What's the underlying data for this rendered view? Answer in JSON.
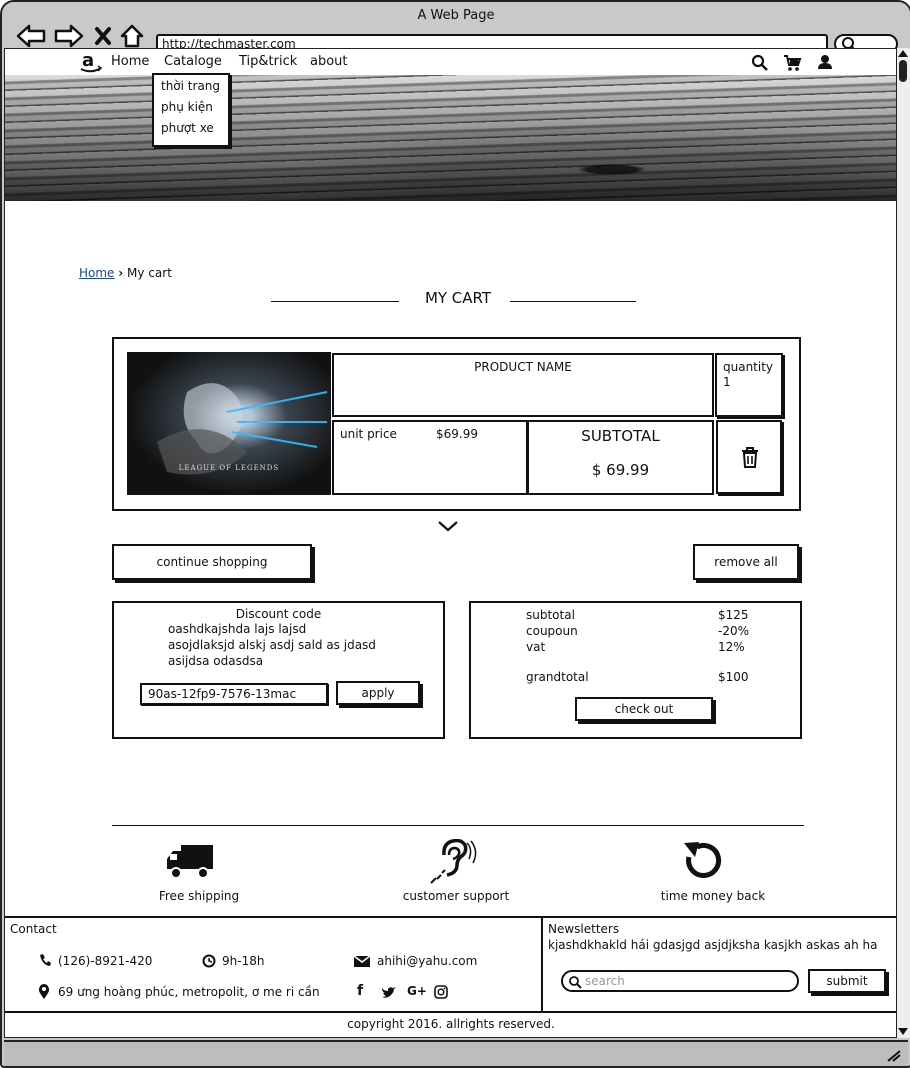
{
  "window": {
    "title": "A Web Page",
    "url": "http://techmaster.com"
  },
  "nav": {
    "items": [
      "Home",
      "Cataloge",
      "Tip&trick",
      "about"
    ],
    "dropdown": [
      "thời trang",
      "phụ kiện",
      "phượt xe"
    ]
  },
  "breadcrumb": {
    "home": "Home",
    "current": "My cart"
  },
  "page_title": "MY CART",
  "cart_item": {
    "image_caption": "LEAGUE OF LEGENDS",
    "product_name": "PRODUCT NAME",
    "quantity_label": "quantity",
    "quantity_value": "1",
    "unit_price_label": "unit price",
    "unit_price_value": "$69.99",
    "subtotal_label": "SUBTOTAL",
    "subtotal_value": "$ 69.99"
  },
  "buttons": {
    "continue_shopping": "continue shopping",
    "remove_all": "remove all",
    "apply": "apply",
    "check_out": "check out",
    "submit": "submit"
  },
  "discount": {
    "title": "Discount code",
    "lines": [
      "oashdkajshda lajs lajsd",
      "asojdlaksjd alskj asdj sald as jdasd",
      "asijdsa odasdsa"
    ],
    "code_value": "90as-12fp9-7576-13mac"
  },
  "summary": {
    "rows": [
      {
        "label": "subtotal",
        "value": "$125"
      },
      {
        "label": "coupoun",
        "value": "-20%"
      },
      {
        "label": "vat",
        "value": "12%"
      }
    ],
    "grandtotal_label": "grandtotal",
    "grandtotal_value": "$100"
  },
  "features": [
    "Free shipping",
    "customer support",
    "time money back"
  ],
  "contact": {
    "title": "Contact",
    "phone": "(126)-8921-420",
    "hours": "9h-18h",
    "email": "ahihi@yahu.com",
    "address": "69 ưng hoàng phúc, metropolit, ơ me ri cần"
  },
  "newsletter": {
    "title": "Newsletters",
    "text": "kjashdkhakld hái gdasjgd asjdjksha kasjkh askas ah ha",
    "search_placeholder": "search"
  },
  "copyright": "copyright 2016. allrights reserved.",
  "icons": [
    "back-arrow-icon",
    "forward-arrow-icon",
    "close-icon",
    "home-icon",
    "search-icon",
    "cart-icon",
    "user-icon",
    "amazon-logo",
    "trash-icon",
    "chevron-down-icon",
    "truck-icon",
    "ear-icon",
    "refresh-icon",
    "phone-icon",
    "clock-icon",
    "mail-icon",
    "location-icon",
    "facebook-icon",
    "twitter-icon",
    "google-plus-icon",
    "instagram-icon"
  ]
}
